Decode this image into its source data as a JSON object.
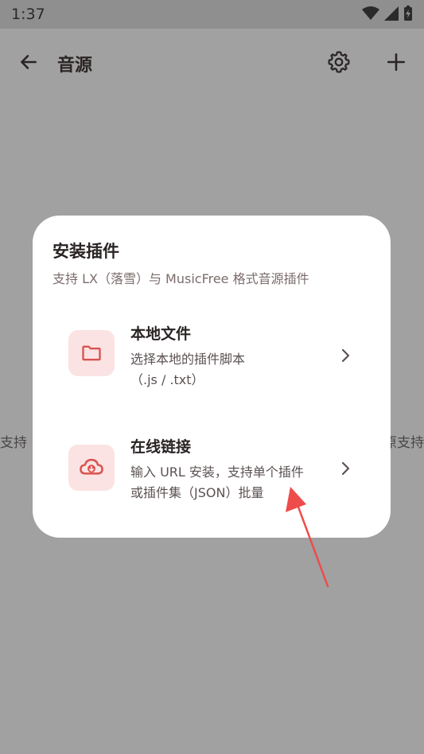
{
  "status_bar": {
    "time": "1:37",
    "icons": [
      "wifi-icon",
      "signal-icon",
      "battery-charging-icon"
    ]
  },
  "app_bar": {
    "title": "音源",
    "back_icon": "arrow-left-icon",
    "settings_icon": "gear-icon",
    "add_icon": "plus-icon"
  },
  "background": {
    "left_text": "支持",
    "right_text": "原支持"
  },
  "dialog": {
    "title": "安装插件",
    "subtitle": "支持 LX（落雪）与 MusicFree 格式音源插件",
    "options": [
      {
        "title": "本地文件",
        "desc_line1": "选择本地的插件脚本",
        "desc_line2": "（.js / .txt）",
        "icon": "folder-icon"
      },
      {
        "title": "在线链接",
        "desc_line1": "输入 URL 安装，支持单个插件",
        "desc_line2": "或插件集（JSON）批量",
        "icon": "cloud-download-icon"
      }
    ]
  },
  "colors": {
    "scrim": "#a1a1a1",
    "accent": "#d9534f",
    "icon_bg": "#fbe3e3",
    "annotation_arrow": "#ee4b4b"
  }
}
